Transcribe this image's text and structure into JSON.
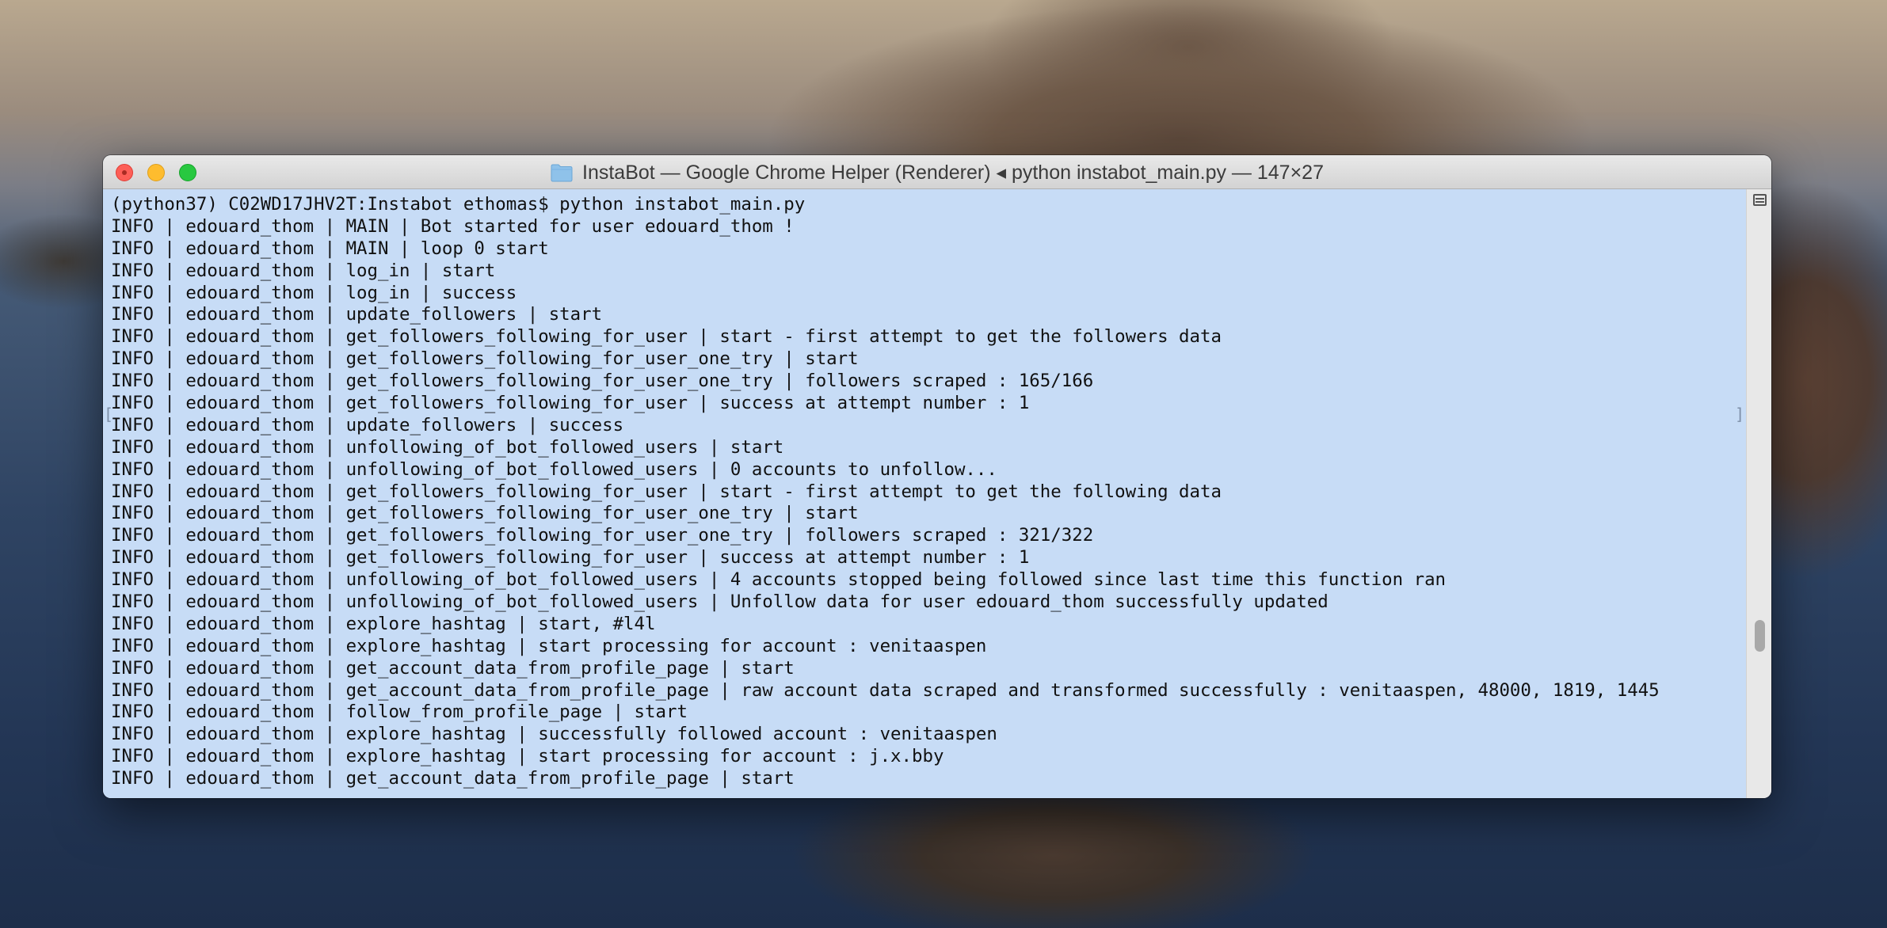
{
  "window": {
    "title": "InstaBot — Google Chrome Helper (Renderer) ◂ python instabot_main.py — 147×27"
  },
  "terminal": {
    "lines": [
      "(python37) C02WD17JHV2T:Instabot ethomas$ python instabot_main.py",
      "INFO | edouard_thom | MAIN | Bot started for user edouard_thom !",
      "INFO | edouard_thom | MAIN | loop 0 start",
      "INFO | edouard_thom | log_in | start",
      "INFO | edouard_thom | log_in | success",
      "INFO | edouard_thom | update_followers | start",
      "INFO | edouard_thom | get_followers_following_for_user | start - first attempt to get the followers data",
      "INFO | edouard_thom | get_followers_following_for_user_one_try | start",
      "INFO | edouard_thom | get_followers_following_for_user_one_try | followers scraped : 165/166",
      "INFO | edouard_thom | get_followers_following_for_user | success at attempt number : 1",
      "INFO | edouard_thom | update_followers | success",
      "INFO | edouard_thom | unfollowing_of_bot_followed_users | start",
      "INFO | edouard_thom | unfollowing_of_bot_followed_users | 0 accounts to unfollow...",
      "INFO | edouard_thom | get_followers_following_for_user | start - first attempt to get the following data",
      "INFO | edouard_thom | get_followers_following_for_user_one_try | start",
      "INFO | edouard_thom | get_followers_following_for_user_one_try | followers scraped : 321/322",
      "INFO | edouard_thom | get_followers_following_for_user | success at attempt number : 1",
      "INFO | edouard_thom | unfollowing_of_bot_followed_users | 4 accounts stopped being followed since last time this function ran",
      "INFO | edouard_thom | unfollowing_of_bot_followed_users | Unfollow data for user edouard_thom successfully updated",
      "INFO | edouard_thom | explore_hashtag | start, #l4l",
      "INFO | edouard_thom | explore_hashtag | start processing for account : venitaaspen",
      "INFO | edouard_thom | get_account_data_from_profile_page | start",
      "INFO | edouard_thom | get_account_data_from_profile_page | raw account data scraped and transformed successfully : venitaaspen, 48000, 1819, 1445",
      "INFO | edouard_thom | follow_from_profile_page | start",
      "INFO | edouard_thom | explore_hashtag | successfully followed account : venitaaspen",
      "INFO | edouard_thom | explore_hashtag | start processing for account : j.x.bby",
      "INFO | edouard_thom | get_account_data_from_profile_page | start"
    ],
    "mark_left": "[",
    "mark_right": "]"
  },
  "colors": {
    "selection_background": "#c7dcf6",
    "close": "#fd5f57",
    "minimize": "#febc2e",
    "maximize": "#28c840"
  },
  "icons": {
    "title": "folder-icon",
    "scrollbar": "split-pane-icon"
  }
}
